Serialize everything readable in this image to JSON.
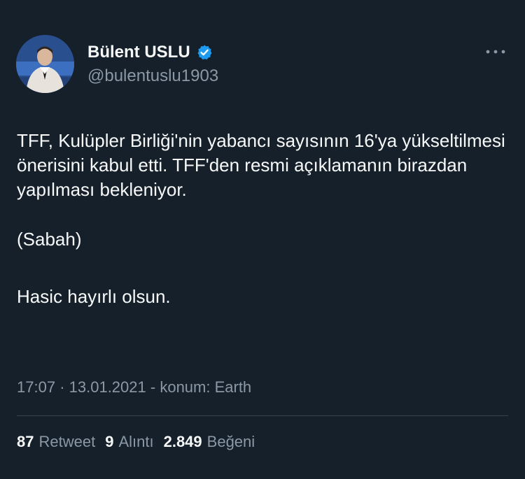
{
  "author": {
    "display_name": "Bülent USLU",
    "handle": "@bulentuslu1903",
    "verified": true
  },
  "tweet": {
    "paragraphs": [
      "TFF, Kulüpler Birliği'nin yabancı sayısının 16'ya yükseltilmesi önerisini kabul etti. TFF'den resmi açıklamanın birazdan yapılması bekleniyor.",
      "(Sabah)",
      "Hasic hayırlı olsun."
    ]
  },
  "meta": {
    "time": "17:07",
    "date": "13.01.2021",
    "location": "konum: Earth"
  },
  "stats": {
    "retweets": "87",
    "retweets_label": "Retweet",
    "quotes": "9",
    "quotes_label": "Alıntı",
    "likes": "2.849",
    "likes_label": "Beğeni"
  },
  "colors": {
    "background": "#15202b",
    "text": "#f7f9f9",
    "secondary": "#8b98a5",
    "verified": "#1d9bf0",
    "divider": "#38444d"
  },
  "icons": {
    "verified": "verified-badge-icon",
    "more": "more-options-icon"
  }
}
